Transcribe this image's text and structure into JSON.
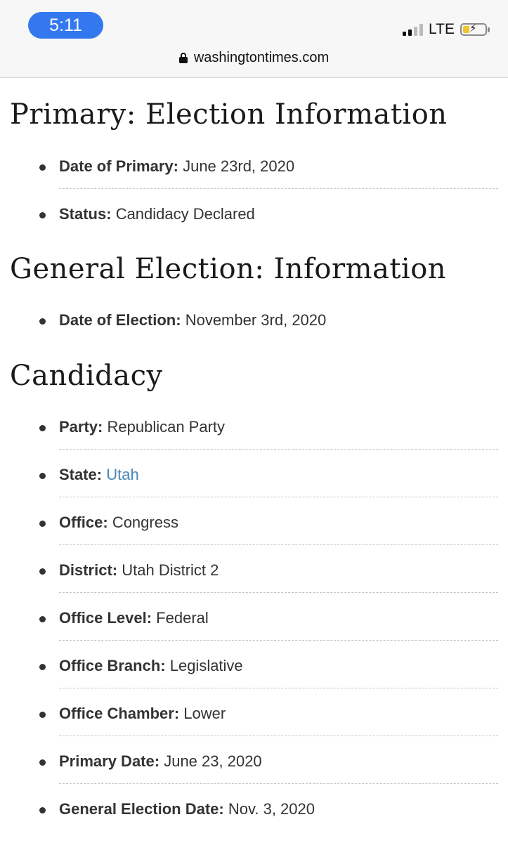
{
  "status_bar": {
    "time": "5:11",
    "network": "LTE",
    "signal_bars_active": 2,
    "signal_bars_total": 4,
    "battery_level": 0.3,
    "battery_charging": true
  },
  "browser": {
    "url": "washingtontimes.com",
    "secure": true
  },
  "sections": {
    "primary": {
      "title": "Primary: Election Information",
      "items": [
        {
          "label": "Date of Primary:",
          "value": "June 23rd, 2020"
        },
        {
          "label": "Status:",
          "value": "Candidacy Declared"
        }
      ]
    },
    "general": {
      "title": "General Election: Information",
      "items": [
        {
          "label": "Date of Election:",
          "value": "November 3rd, 2020"
        }
      ]
    },
    "candidacy": {
      "title": "Candidacy",
      "items": [
        {
          "label": "Party:",
          "value": "Republican Party"
        },
        {
          "label": "State:",
          "value": "Utah"
        },
        {
          "label": "Office:",
          "value": "Congress"
        },
        {
          "label": "District:",
          "value": "Utah District 2"
        },
        {
          "label": "Office Level:",
          "value": "Federal"
        },
        {
          "label": "Office Branch:",
          "value": "Legislative"
        },
        {
          "label": "Office Chamber:",
          "value": "Lower"
        },
        {
          "label": "Primary Date:",
          "value": "June 23, 2020"
        },
        {
          "label": "General Election Date:",
          "value": "Nov. 3, 2020"
        }
      ]
    }
  },
  "colors": {
    "link": "#4a86b8",
    "time_pill": "#3478f0",
    "battery_fill": "#f2c22e"
  }
}
